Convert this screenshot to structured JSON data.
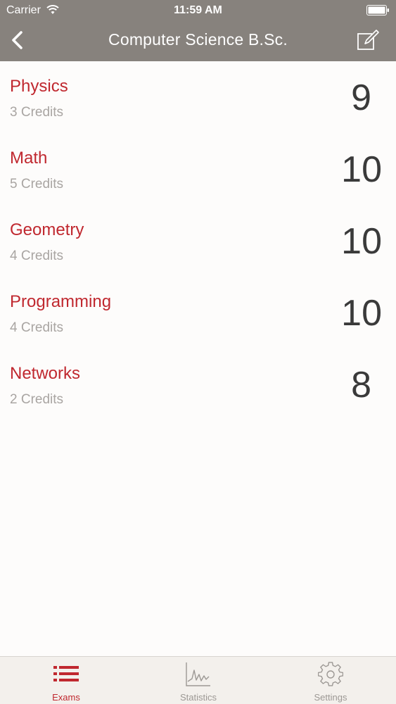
{
  "status_bar": {
    "carrier": "Carrier",
    "time": "11:59 AM"
  },
  "nav": {
    "title": "Computer Science B.Sc.",
    "back_icon": "chevron-left-icon",
    "edit_icon": "compose-icon"
  },
  "courses": [
    {
      "name": "Physics",
      "credits": "3 Credits",
      "grade": "9"
    },
    {
      "name": "Math",
      "credits": "5 Credits",
      "grade": "10"
    },
    {
      "name": "Geometry",
      "credits": "4 Credits",
      "grade": "10"
    },
    {
      "name": "Programming",
      "credits": "4 Credits",
      "grade": "10"
    },
    {
      "name": "Networks",
      "credits": "2 Credits",
      "grade": "8"
    }
  ],
  "tabs": [
    {
      "label": "Exams",
      "icon": "list-icon",
      "active": true
    },
    {
      "label": "Statistics",
      "icon": "chart-icon",
      "active": false
    },
    {
      "label": "Settings",
      "icon": "gear-icon",
      "active": false
    }
  ],
  "colors": {
    "accent": "#c0282f",
    "nav_background": "#87827d",
    "grade_text": "#3a3a3a",
    "muted_text": "#a9a5a2"
  }
}
